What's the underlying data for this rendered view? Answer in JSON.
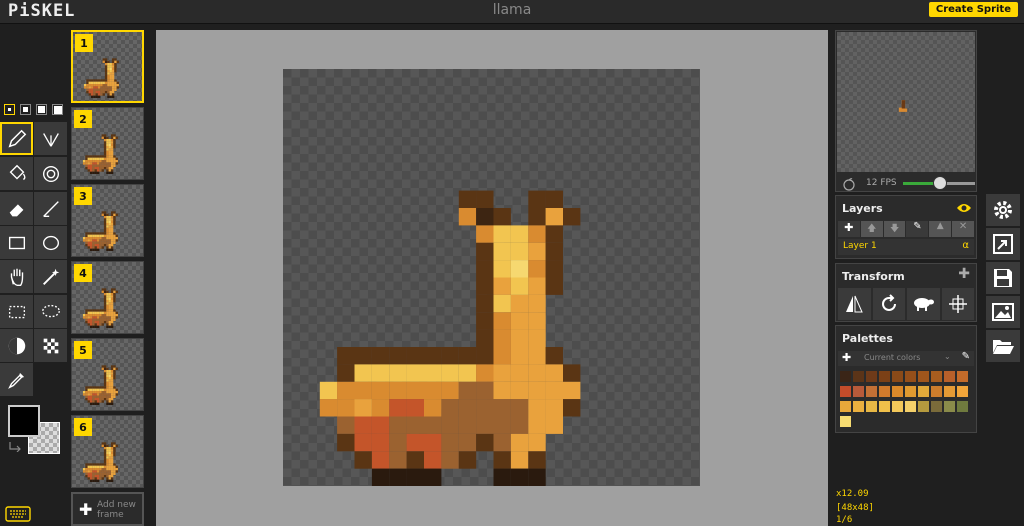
{
  "header": {
    "logo": "PiSKEL",
    "title": "llama",
    "create_label": "Create Sprite"
  },
  "frames": [
    "1",
    "2",
    "3",
    "4",
    "5",
    "6"
  ],
  "add_frame_label": "Add new frame",
  "preview": {
    "fps_label": "12 FPS",
    "fps_level": 0.5
  },
  "layers": {
    "title": "Layers",
    "items": [
      {
        "name": "Layer 1",
        "alpha": "α"
      }
    ]
  },
  "transform": {
    "title": "Transform"
  },
  "palettes": {
    "title": "Palettes",
    "selected": "Current colors",
    "colors": [
      "#3a2517",
      "#5b3418",
      "#6e3a19",
      "#7b4016",
      "#8a4a18",
      "#954f1a",
      "#a0561c",
      "#a85d1f",
      "#b8602a",
      "#c46b2a",
      "#c44c2a",
      "#b85a3a",
      "#c37035",
      "#d07a2c",
      "#dc8a2a",
      "#e09a30",
      "#e1a93a",
      "#cd7d2c",
      "#e59a35",
      "#f1a53a",
      "#e8a83a",
      "#eab03f",
      "#e8b845",
      "#f0c04a",
      "#f3c85a",
      "#f4d06a",
      "#b59a3e",
      "#7a6b3a",
      "#8a8b4a",
      "#6f7a3e",
      "#f7dc72"
    ]
  },
  "status": {
    "zoom": "x12.09",
    "size": "[48x48]",
    "frame": "1/6"
  },
  "colors": {
    "primary": "#000000",
    "accent": "#ffd700"
  }
}
